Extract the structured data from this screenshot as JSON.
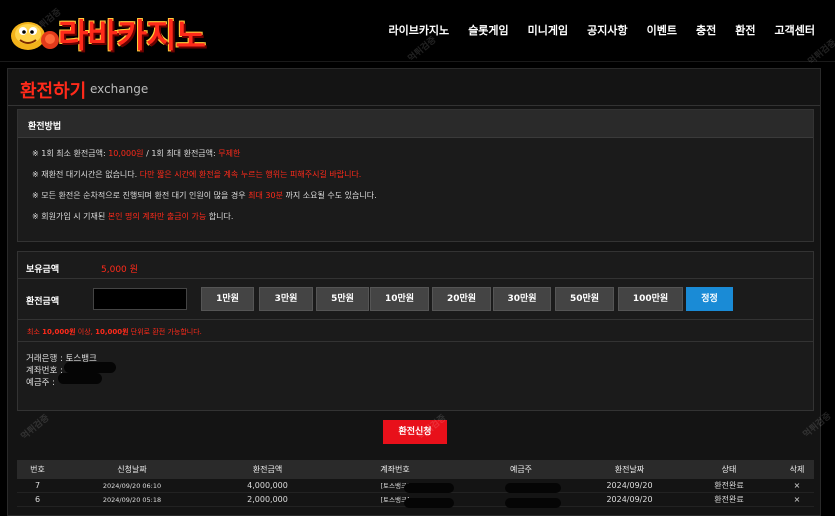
{
  "logo": {
    "text": "라바카지노"
  },
  "nav": [
    "라이브카지노",
    "슬롯게임",
    "미니게임",
    "공지사항",
    "이벤트",
    "충전",
    "환전",
    "고객센터"
  ],
  "page": {
    "title": "환전하기",
    "subtitle": "exchange"
  },
  "info": {
    "heading": "환전방법",
    "lines": [
      {
        "a": "※ 1회 최소 환전금액: ",
        "b": "10,000원",
        "c": " / 1회 최대 환전금액: ",
        "d": "무제한",
        "e": ""
      },
      {
        "a": "※ 재환전 대기시간은 없습니다. ",
        "b": "다만 짧은 시간에 환전을 계속 누르는 행위는 피해주시길 바랍니다.",
        "c": "",
        "d": "",
        "e": ""
      },
      {
        "a": "※ 모든 환전은 순차적으로 진행되며 환전 대기 인원이 많을 경우 ",
        "b": "최대 30분",
        "c": " 까지 소요될 수도 있습니다.",
        "d": "",
        "e": ""
      },
      {
        "a": "※ 회원가입 시 기재된 ",
        "b": "본인 명의 계좌만 출금이 가능",
        "c": " 합니다.",
        "d": "",
        "e": ""
      }
    ]
  },
  "form": {
    "balance_label": "보유금액",
    "balance_value": "5,000 원",
    "amount_label": "환전금액",
    "amount_value": "",
    "buttons": [
      "1만원",
      "3만원",
      "5만원",
      "10만원",
      "20만원",
      "30만원",
      "50만원",
      "100만원"
    ],
    "reset_label": "정정",
    "note": {
      "a": "최소 ",
      "b": "10,000원",
      "c": " 이상, ",
      "d": "10,000원",
      "e": " 단위로 환전 가능합니다."
    },
    "bank": "거래은행 : 토스뱅크",
    "account_label": "계좌번호 :",
    "holder_label": "예금주 :"
  },
  "apply_label": "환전신청",
  "table": {
    "headers": [
      "번호",
      "신청날짜",
      "환전금액",
      "계좌번호",
      "예금주",
      "환전날짜",
      "상태",
      "삭제"
    ],
    "rows": [
      {
        "no": "7",
        "req": "2024/09/20 06:10",
        "amount": "4,000,000",
        "account": "[토스뱅크]",
        "holder": "",
        "date": "2024/09/20",
        "status": "환전완료",
        "del": "×"
      },
      {
        "no": "6",
        "req": "2024/09/20 05:18",
        "amount": "2,000,000",
        "account": "[토스뱅크]",
        "holder": "",
        "date": "2024/09/20",
        "status": "환전완료",
        "del": "×"
      }
    ]
  },
  "watermark": "먹튀검증"
}
